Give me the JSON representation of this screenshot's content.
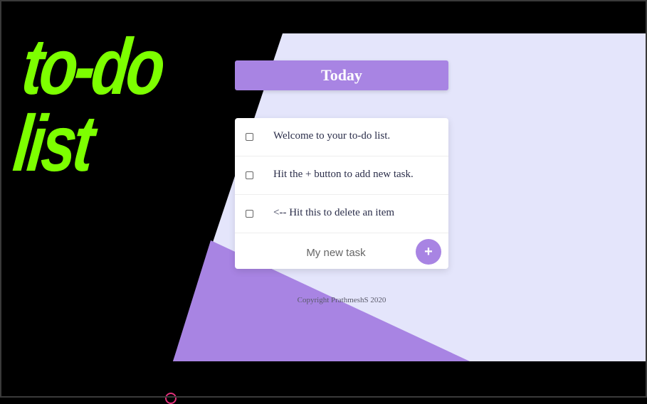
{
  "title_art": {
    "line1": "to-do",
    "line2": "list"
  },
  "header": {
    "title": "Today"
  },
  "todo": {
    "items": [
      {
        "label": "Welcome to your to-do list.",
        "checked": false
      },
      {
        "label": "Hit the + button to add new task.",
        "checked": false
      },
      {
        "label": "<-- Hit this to delete an item",
        "checked": false
      }
    ],
    "input_placeholder": "My new task",
    "add_button_label": "+"
  },
  "footer": {
    "copyright": "Copyright PrathmeshS 2020"
  },
  "colors": {
    "accent": "#a884e3",
    "background": "#e4e5fb",
    "title_art": "#7dff00"
  }
}
